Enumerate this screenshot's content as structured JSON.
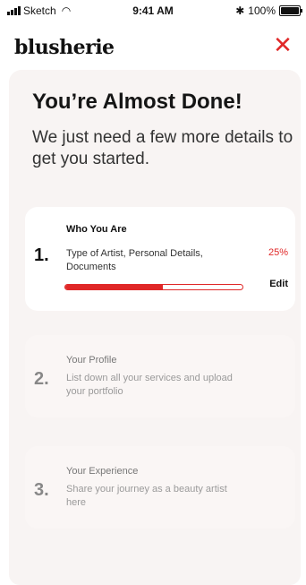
{
  "status_bar": {
    "carrier": "Sketch",
    "time": "9:41 AM",
    "battery": "100%"
  },
  "header": {
    "logo": "blusherie",
    "close_icon": "close-icon"
  },
  "main": {
    "title": "You’re Almost Done!",
    "subtitle": "We just need a few more details to get you started."
  },
  "steps": [
    {
      "number": "1.",
      "title": "Who You Are",
      "description": "Type of Artist, Personal Details, Documents",
      "percent": "25%",
      "progress": 0.55,
      "edit_label": "Edit"
    },
    {
      "number": "2.",
      "title": "Your Profile",
      "description": "List down all your services and upload your portfolio"
    },
    {
      "number": "3.",
      "title": "Your Experience",
      "description": "Share your journey as a beauty artist here"
    }
  ],
  "colors": {
    "accent": "#e02828",
    "panel": "#f8f4f3"
  }
}
